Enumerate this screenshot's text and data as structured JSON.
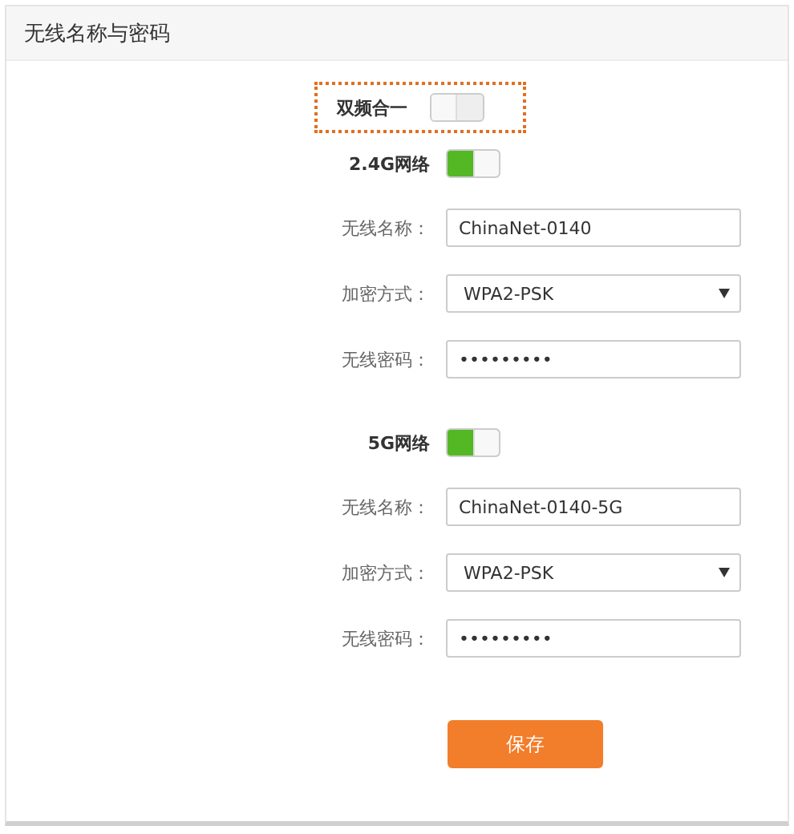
{
  "panel": {
    "title": "无线名称与密码"
  },
  "dual_band": {
    "label": "双频合一",
    "on": false,
    "highlighted": true
  },
  "networks": [
    {
      "label": "2.4G网络",
      "on": true,
      "fields": [
        {
          "kind": "text",
          "label": "无线名称：",
          "value": "ChinaNet-0140"
        },
        {
          "kind": "select",
          "label": "加密方式：",
          "value": "WPA2-PSK"
        },
        {
          "kind": "text",
          "label": "无线密码：",
          "value": "•••••••••"
        }
      ]
    },
    {
      "label": "5G网络",
      "on": true,
      "fields": [
        {
          "kind": "text",
          "label": "无线名称：",
          "value": "ChinaNet-0140-5G"
        },
        {
          "kind": "select",
          "label": "加密方式：",
          "value": "WPA2-PSK"
        },
        {
          "kind": "text",
          "label": "无线密码：",
          "value": "•••••••••"
        }
      ]
    }
  ],
  "save_button": "保存"
}
